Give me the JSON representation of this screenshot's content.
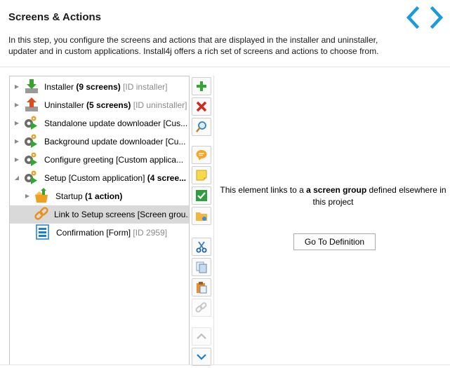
{
  "header": {
    "title": "Screens & Actions",
    "description": "In this step, you configure the screens and actions that are displayed in the installer and uninstaller, updater and in custom applications. Install4j offers a rich set of screens and actions to choose from."
  },
  "nav": {
    "back_icon": "chevron-left-icon",
    "forward_icon": "chevron-right-icon",
    "accent": "#1a9be0"
  },
  "tree": {
    "items": [
      {
        "name": "Installer",
        "count": "(9 screens)",
        "id": "[ID installer]",
        "icon": "installer-down-arrow-icon"
      },
      {
        "name": "Uninstaller",
        "count": "(5 screens)",
        "id": "[ID uninstaller]",
        "icon": "uninstaller-up-arrow-icon"
      },
      {
        "name": "Standalone update downloader [Cus...",
        "icon": "gear-play-icon"
      },
      {
        "name": "Background update downloader [Cu...",
        "icon": "gear-play-icon"
      },
      {
        "name": "Configure greeting [Custom applica...",
        "icon": "gear-play-icon"
      },
      {
        "name": "Setup [Custom application]",
        "count": "(4 scree...",
        "icon": "gear-play-icon"
      },
      {
        "name": "Startup",
        "count": "(1 action)",
        "icon": "startup-box-icon"
      },
      {
        "name": "Link to Setup screens [Screen grou...",
        "icon": "chain-link-icon"
      },
      {
        "name": "Confirmation [Form]",
        "id": "[ID 2959]",
        "icon": "form-icon"
      }
    ]
  },
  "toolbar": {
    "buttons": [
      {
        "icon": "add-icon",
        "label": "Add"
      },
      {
        "icon": "delete-icon",
        "label": "Delete"
      },
      {
        "icon": "search-icon",
        "label": "Search"
      },
      {
        "icon": "comment-icon",
        "label": "Comment"
      },
      {
        "icon": "note-icon",
        "label": "Note"
      },
      {
        "icon": "checkbox-icon",
        "label": "Enable"
      },
      {
        "icon": "folder-icon",
        "label": "Folder"
      },
      {
        "icon": "cut-icon",
        "label": "Cut"
      },
      {
        "icon": "copy-icon",
        "label": "Copy"
      },
      {
        "icon": "paste-icon",
        "label": "Paste"
      },
      {
        "icon": "link-icon",
        "label": "Link"
      },
      {
        "icon": "move-up-icon",
        "label": "Move up"
      },
      {
        "icon": "move-down-icon",
        "label": "Move down"
      }
    ]
  },
  "detail": {
    "text_before": "This element links to a ",
    "text_bold": "a screen group",
    "text_after": " defined elsewhere in this project",
    "button_label": "Go To Definition"
  }
}
